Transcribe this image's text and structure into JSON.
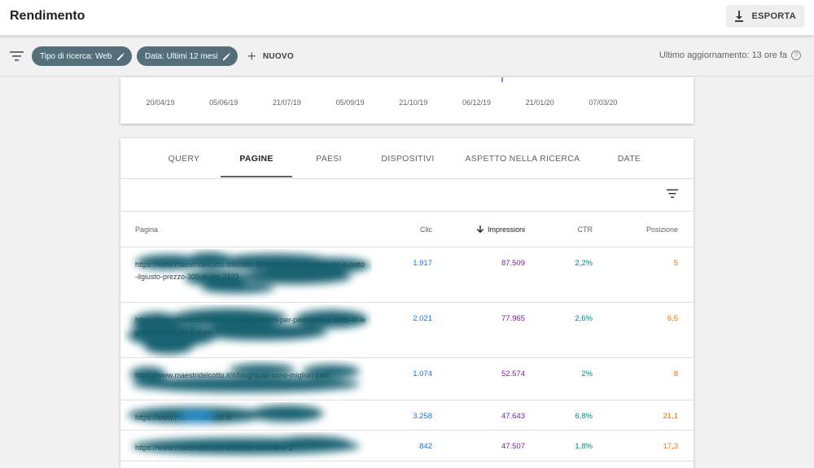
{
  "header": {
    "title": "Rendimento",
    "export_label": "ESPORTA"
  },
  "filters": {
    "chips": [
      "Tipo di ricerca: Web",
      "Data: Ultimi 12 mesi"
    ],
    "new_label": "NUOVO",
    "last_update": "Ultimo aggiornamento: 13 ore fa"
  },
  "chart_data": {
    "type": "line",
    "x_tick_labels": [
      "20/04/19",
      "05/06/19",
      "21/07/19",
      "05/09/19",
      "21/10/19",
      "06/12/19",
      "21/01/20",
      "07/03/20"
    ],
    "series": [
      {
        "color": "#1a73e8"
      }
    ]
  },
  "tabs": [
    {
      "label": "QUERY",
      "active": false
    },
    {
      "label": "PAGINE",
      "active": true
    },
    {
      "label": "PAESI",
      "active": false
    },
    {
      "label": "DISPOSITIVI",
      "active": false
    },
    {
      "label": "ASPETTO NELLA RICERCA",
      "active": false
    },
    {
      "label": "DATE",
      "active": false
    }
  ],
  "table": {
    "columns": {
      "page": "Pagina",
      "clic": "Clic",
      "impressions": "Impressioni",
      "ctr": "CTR",
      "position": "Posizione"
    },
    "rows": [
      {
        "url": "https://www.maestridelcotto.it/it/cotto-fiorentino-prezzi-piastrelle-e-cotto-ilgiusto-prezzo-300-al-mq-2123",
        "clic": "1.917",
        "impressions": "87.509",
        "ctr": "2,2%",
        "position": "5"
      },
      {
        "url": "https://www.maestridelcotto.it/it/blog/mattoni-per-pavimenti-e-cotto-in-legno-a-partire-da-1-euro",
        "clic": "2.021",
        "impressions": "77.965",
        "ctr": "2,6%",
        "position": "6,5"
      },
      {
        "url": "https://www.maestridelcotto.it/it/blog/quali-sono-migliori-pavi",
        "clic": "1.074",
        "impressions": "52.574",
        "ctr": "2%",
        "position": "8"
      },
      {
        "url": "https://www.maestridelcotto.it/",
        "clic": "3.258",
        "impressions": "47.643",
        "ctr": "6,8%",
        "position": "21,1"
      },
      {
        "url": "https://www.maestridelcotto.it/it/cotto-fiorentino-2",
        "clic": "842",
        "impressions": "47.507",
        "ctr": "1,8%",
        "position": "17,3"
      }
    ]
  },
  "colors": {
    "chip_bg": "#546e7a",
    "clic": "#1a73e8",
    "impressions": "#7b1fa2",
    "ctr": "#00897b",
    "position": "#e8710a",
    "blur": "#0f5a6b"
  }
}
